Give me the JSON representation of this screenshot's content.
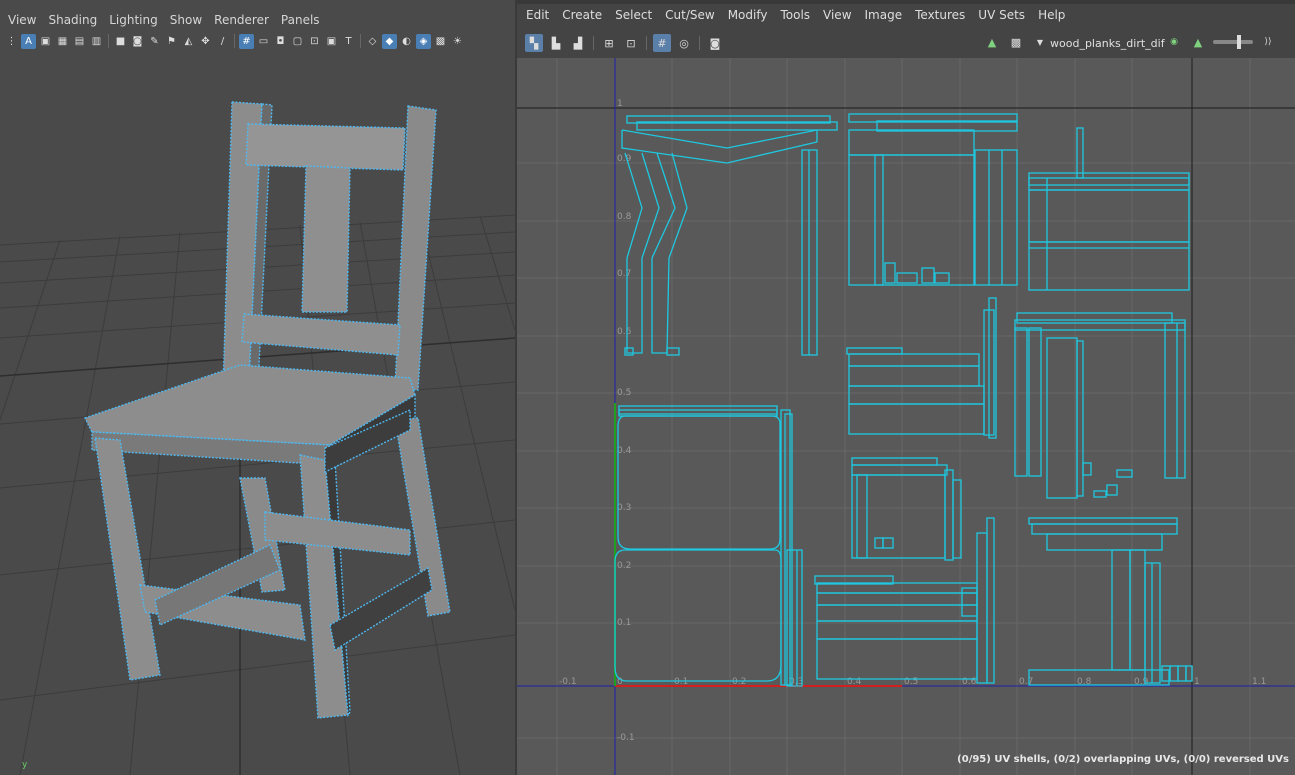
{
  "viewport": {
    "menus": [
      "View",
      "Shading",
      "Lighting",
      "Show",
      "Renderer",
      "Panels"
    ],
    "axis_label": "y"
  },
  "uv_editor": {
    "menus": [
      "Edit",
      "Create",
      "Select",
      "Cut/Sew",
      "Modify",
      "Tools",
      "View",
      "Image",
      "Textures",
      "UV Sets",
      "Help"
    ],
    "texture_name": "wood_planks_dirt_dif",
    "status": "(0/95) UV shells, (0/2) overlapping UVs, (0/0) reversed UVs",
    "axis_ticks_x": [
      "-0.1",
      "0",
      "0.1",
      "0.2",
      "0.3",
      "0.4",
      "0.5",
      "0.6",
      "0.7",
      "0.8",
      "0.9",
      "1",
      "1.1"
    ],
    "axis_ticks_y": [
      "1",
      "0.9",
      "0.8",
      "0.7",
      "0.6",
      "0.5",
      "0.4",
      "0.3",
      "0.2",
      "0.1",
      "-0.1"
    ]
  },
  "colors": {
    "uv_wire": "#1ec8e0",
    "selection": "#4fb8f0",
    "axis_u": "#d02020",
    "axis_v": "#20a020",
    "grid_axis": "#1a1aa0"
  }
}
